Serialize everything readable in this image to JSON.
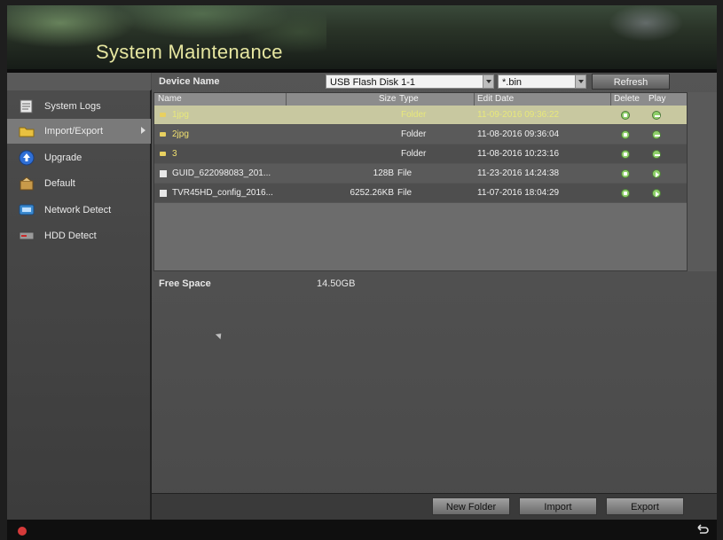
{
  "header": {
    "title": "System Maintenance"
  },
  "sidebar": {
    "items": [
      {
        "label": "System Logs",
        "icon": "log-icon",
        "active": false
      },
      {
        "label": "Import/Export",
        "icon": "folder-icon",
        "active": true
      },
      {
        "label": "Upgrade",
        "icon": "upgrade-icon",
        "active": false
      },
      {
        "label": "Default",
        "icon": "default-icon",
        "active": false
      },
      {
        "label": "Network Detect",
        "icon": "network-icon",
        "active": false
      },
      {
        "label": "HDD Detect",
        "icon": "hdd-icon",
        "active": false
      }
    ]
  },
  "device": {
    "label": "Device Name",
    "selected": "USB Flash Disk 1-1",
    "extension": "*.bin",
    "refresh_label": "Refresh"
  },
  "table": {
    "headers": {
      "name": "Name",
      "size": "Size",
      "type": "Type",
      "edit_date": "Edit Date",
      "delete": "Delete",
      "play": "Play"
    },
    "rows": [
      {
        "name": "1jpg",
        "size": "",
        "type": "Folder",
        "date": "11-09-2016 09:36:22",
        "kind": "folder",
        "play_icon": "minus"
      },
      {
        "name": "2jpg",
        "size": "",
        "type": "Folder",
        "date": "11-08-2016 09:36:04",
        "kind": "folder",
        "play_icon": "minus"
      },
      {
        "name": "3",
        "size": "",
        "type": "Folder",
        "date": "11-08-2016 10:23:16",
        "kind": "folder",
        "play_icon": "minus"
      },
      {
        "name": "GUID_622098083_201...",
        "size": "128B",
        "type": "File",
        "date": "11-23-2016 14:24:38",
        "kind": "file",
        "play_icon": "play"
      },
      {
        "name": "TVR45HD_config_2016...",
        "size": "6252.26KB",
        "type": "File",
        "date": "11-07-2016 18:04:29",
        "kind": "file",
        "play_icon": "play"
      }
    ]
  },
  "free_space": {
    "label": "Free Space",
    "value": "14.50GB"
  },
  "buttons": {
    "new_folder": "New Folder",
    "import": "Import",
    "export": "Export"
  },
  "colors": {
    "title_yellow": "#e6e6a0",
    "selected_row": "#c8c8a0",
    "ok_green": "#8fd06a",
    "rec_red": "#d63a3a"
  }
}
